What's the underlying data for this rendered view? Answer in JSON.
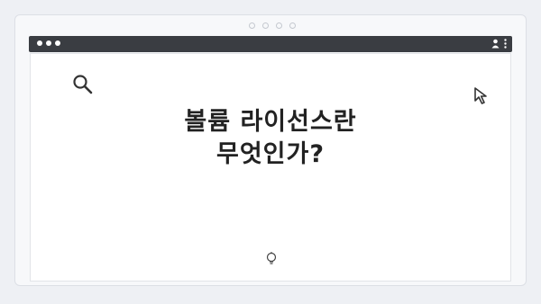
{
  "window": {
    "titlebar_dots": 3
  },
  "main": {
    "headline_line1": "볼륨 라이선스란",
    "headline_line2": "무엇인가?"
  },
  "icons": {
    "top_left": "search-icon",
    "top_right": "cursor-arrow-icon",
    "bottom_center": "lightbulb-icon",
    "titlebar_right": [
      "user-icon",
      "more-vertical-icon"
    ]
  },
  "colors": {
    "titlebar": "#3a3d42",
    "background": "#eef0f4",
    "text": "#222222"
  }
}
